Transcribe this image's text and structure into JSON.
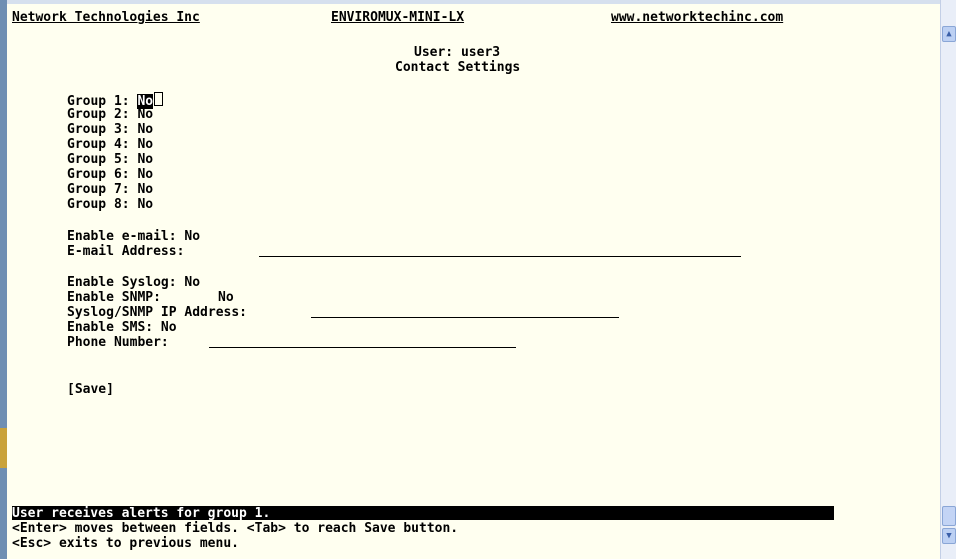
{
  "header": {
    "company": "Network Technologies Inc",
    "product": "ENVIROMUX-MINI-LX",
    "website": "www.networktechinc.com"
  },
  "page": {
    "user_line": "User: user3",
    "title": "Contact Settings"
  },
  "groups": [
    {
      "label": "Group 1:",
      "value": "No"
    },
    {
      "label": "Group 2:",
      "value": "No"
    },
    {
      "label": "Group 3:",
      "value": "No"
    },
    {
      "label": "Group 4:",
      "value": "No"
    },
    {
      "label": "Group 5:",
      "value": "No"
    },
    {
      "label": "Group 6:",
      "value": "No"
    },
    {
      "label": "Group 7:",
      "value": "No"
    },
    {
      "label": "Group 8:",
      "value": "No"
    }
  ],
  "email": {
    "enable_label": "Enable e-mail:",
    "enable_value": "No",
    "address_label": "E-mail Address:",
    "address_value": ""
  },
  "syslog": {
    "enable_label": "Enable Syslog:",
    "enable_value": "No",
    "snmp_label": "Enable SNMP:",
    "snmp_value": "No",
    "ip_label": "Syslog/SNMP IP Address:",
    "ip_value": "",
    "sms_label": "Enable SMS:",
    "sms_value": "No",
    "phone_label": "Phone Number:",
    "phone_value": ""
  },
  "save_label": "[Save]",
  "status": {
    "message": "User receives alerts for group 1.",
    "help1": "<Enter> moves between fields. <Tab> to reach Save button.",
    "help2": "<Esc> exits to previous menu."
  },
  "scrollbar": {
    "up_icon": "chevron-up-icon",
    "down_icon": "chevron-down-icon"
  }
}
